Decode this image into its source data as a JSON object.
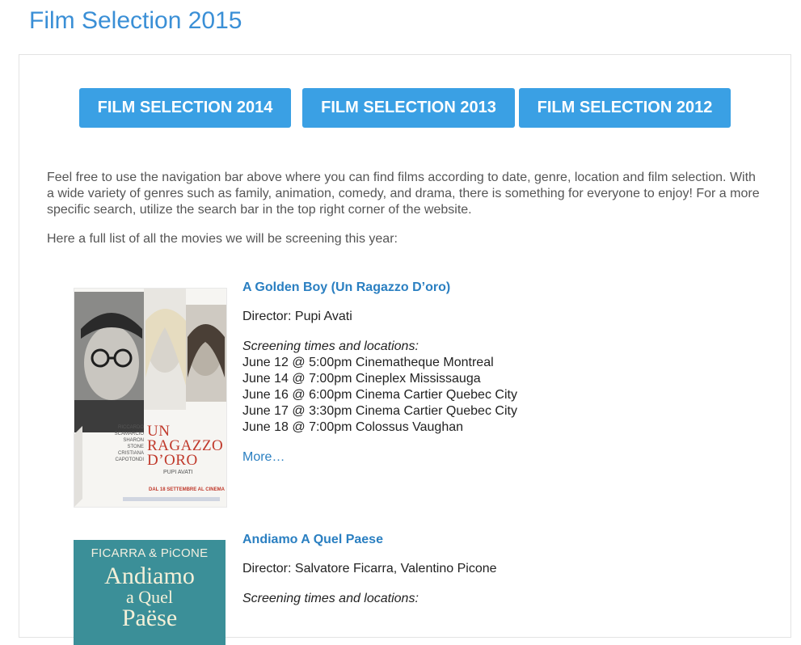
{
  "page": {
    "title": "Film Selection 2015"
  },
  "nav_buttons": [
    {
      "label": "FILM SELECTION 2014"
    },
    {
      "label": "FILM SELECTION 2013"
    },
    {
      "label": "FILM SELECTION 2012"
    }
  ],
  "intro": {
    "paragraph": "Feel free to use the navigation bar above where you can find films according to date, genre, location and film selection. With a wide variety of genres such as family, animation, comedy, and drama, there is something for everyone to enjoy! For a more specific search, utilize the search bar in the top right corner of the website.",
    "list_lead": "Here a full list of all the movies we will be screening this year:"
  },
  "films": [
    {
      "title": "A Golden Boy (Un Ragazzo D’oro)",
      "director": "Director: Pupi Avati",
      "screening_heading": "Screening times and locations:",
      "screenings": [
        "June 12 @ 5:00pm Cinematheque Montreal",
        "June 14 @ 7:00pm Cineplex Mississauga",
        "June 16 @ 6:00pm Cinema Cartier Quebec City",
        "June 17 @ 3:30pm Cinema Cartier Quebec City",
        "June 18 @ 7:00pm Colossus Vaughan"
      ],
      "more_label": "More…",
      "poster": {
        "title_lines": [
          "UN",
          "RAGAZZO",
          "D’ORO"
        ],
        "cast_lines": [
          "RICCARDO",
          "SCAMARCIO",
          "SHARON",
          "STONE",
          "CRISTIANA",
          "CAPOTONDI"
        ],
        "director_line": "PUPI AVATI",
        "release_line": "DAL 18 SETTEMBRE AL CINEMA",
        "accent_color": "#c0392b"
      }
    },
    {
      "title": "Andiamo A Quel Paese",
      "director": "Director: Salvatore Ficarra, Valentino Picone",
      "screening_heading": "Screening times and locations:",
      "poster": {
        "top_line": "FICARRA & PiCONE",
        "title_lines": [
          "Andiamo",
          "a Quel",
          "Paëse"
        ],
        "bg_color": "#3b8f98"
      }
    }
  ],
  "colors": {
    "title_blue": "#3a8fd6",
    "button_blue": "#3aa0e4",
    "link_blue": "#2a7fc1"
  }
}
